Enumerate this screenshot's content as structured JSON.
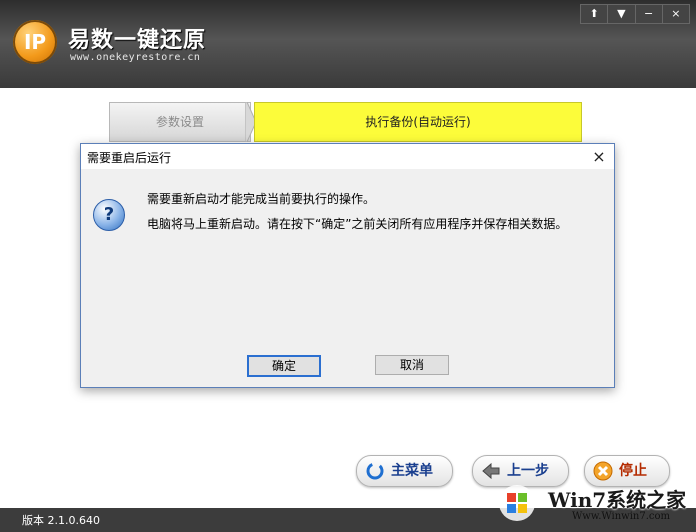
{
  "header": {
    "logo_letters": "IP",
    "title": "易数一键还原",
    "url": "www.onekeyrestore.cn",
    "window_controls": [
      "⬆",
      "▼",
      "−",
      "×"
    ]
  },
  "steps": [
    {
      "label": "参数设置",
      "state": "done"
    },
    {
      "label": "执行备份(自动运行)",
      "state": "active"
    }
  ],
  "colors": {
    "active_step": "#fcfc3a",
    "dialog_border": "#5b7fb8",
    "header": "#3a3a3a"
  },
  "dialog": {
    "title": "需要重启后运行",
    "close_icon": "×",
    "help_icon": "?",
    "message_line1": "需要重新启动才能完成当前要执行的操作。",
    "message_line2": "电脑将马上重新启动。请在按下“确定”之前关闭所有应用程序并保存相关数据。",
    "ok_label": "确定",
    "cancel_label": "取消"
  },
  "bottom_buttons": {
    "menu_label": "主菜单",
    "back_label": "上一步",
    "stop_label": "停止"
  },
  "status": {
    "version": "版本 2.1.0.640"
  },
  "watermark": {
    "text": "Win7系统之家",
    "url": "Www.Winwin7.com"
  }
}
